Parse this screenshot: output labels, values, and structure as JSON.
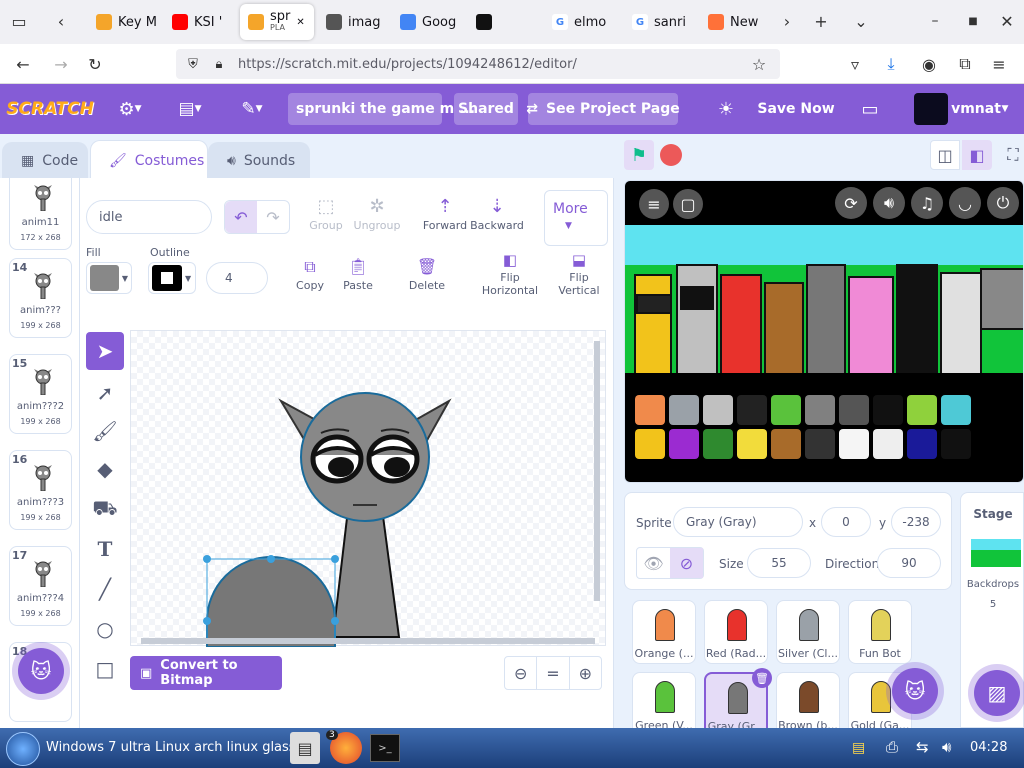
{
  "browser": {
    "tabs": [
      {
        "label": "Key M",
        "fav_color": "#f4a52a",
        "icon": "scratch-favicon"
      },
      {
        "label": "KSI '",
        "fav_color": "#ff0000",
        "icon": "youtube-favicon"
      },
      {
        "label": "spr",
        "sublabel": "PLA",
        "fav_color": "#f4a52a",
        "icon": "scratch-favicon",
        "active": true
      },
      {
        "label": "imag",
        "fav_color": "#555555",
        "icon": "image-favicon"
      },
      {
        "label": "Goog",
        "fav_color": "#4285f4",
        "icon": "docs-favicon"
      },
      {
        "label": "",
        "fav_color": "#111111",
        "icon": "qr-favicon"
      },
      {
        "label": "elmo",
        "fav_color": "#ffffff",
        "icon": "google-favicon"
      },
      {
        "label": "sanri",
        "fav_color": "#ffffff",
        "icon": "google-favicon"
      },
      {
        "label": "New",
        "fav_color": "#ff7139",
        "icon": "firefox-favicon"
      }
    ],
    "url": "https://scratch.mit.edu/projects/1094248612/editor/"
  },
  "menubar": {
    "logo": "SCRATCH",
    "project_title": "sprunki the game m ...",
    "shared_label": "Shared",
    "see_project_label": "See Project Page",
    "save_now_label": "Save Now",
    "username": "vmnat"
  },
  "editor_tabs": {
    "code": "Code",
    "costumes": "Costumes",
    "sounds": "Sounds"
  },
  "costumes": [
    {
      "num": "",
      "name": "anim11",
      "size": "172 x 268"
    },
    {
      "num": "14",
      "name": "anim???",
      "size": "199 x 268"
    },
    {
      "num": "15",
      "name": "anim???2",
      "size": "199 x 268"
    },
    {
      "num": "16",
      "name": "anim???3",
      "size": "199 x 268"
    },
    {
      "num": "17",
      "name": "anim???4",
      "size": "199 x 268"
    },
    {
      "num": "18",
      "name": "",
      "size": ""
    }
  ],
  "paint": {
    "costume_name": "idle",
    "group_label": "Group",
    "ungroup_label": "Ungroup",
    "forward_label": "Forward",
    "backward_label": "Backward",
    "more_label": "More",
    "fill_label": "Fill",
    "fill_color": "#888888",
    "outline_label": "Outline",
    "outline_width": "4",
    "copy_label": "Copy",
    "paste_label": "Paste",
    "delete_label": "Delete",
    "flip_h_label": "Flip\nHorizontal",
    "flip_v_label": "Flip\nVertical",
    "convert_label": "Convert to Bitmap",
    "zoom_reset": "="
  },
  "sprite_info": {
    "sprite_label": "Sprite",
    "sprite_name": "Gray (Gray)",
    "x_label": "x",
    "x": "0",
    "y_label": "y",
    "y": "-238",
    "size_label": "Size",
    "size": "55",
    "direction_label": "Direction",
    "direction": "90"
  },
  "sprites": [
    {
      "name": "Orange (...",
      "color": "#f08a4b"
    },
    {
      "name": "Red (Rad...",
      "color": "#e8322c"
    },
    {
      "name": "Silver (Cl...",
      "color": "#9aa1a8"
    },
    {
      "name": "Fun Bot",
      "color": "#e3d25a"
    },
    {
      "name": "Green (V...",
      "color": "#5ac23c"
    },
    {
      "name": "Gray (Gr...",
      "color": "#777777",
      "selected": true
    },
    {
      "name": "Brown (b...",
      "color": "#7b4a2a"
    },
    {
      "name": "Gold (Ga...",
      "color": "#e8c53b"
    }
  ],
  "stage_panel": {
    "label": "Stage",
    "backdrops_label": "Backdrops",
    "backdrops_count": "5"
  },
  "taskbar": {
    "start_text": "Windows 7 ultra Linux arch linux glass",
    "firefox_badge": "3",
    "clock": "04:28"
  },
  "palette_row1": [
    "#f08a4b",
    "#9aa1a8",
    "#c0c0c0",
    "#222222",
    "#5ac23c",
    "#808080",
    "#555555",
    "#111111",
    "#8fd13c",
    "#4ec9d6"
  ],
  "palette_row2": [
    "#f2c31b",
    "#9b2bd1",
    "#2f8a2f",
    "#f2dc3b",
    "#a86b2a",
    "#333333",
    "#f5f5f5",
    "#eeeeee",
    "#1a1a99",
    "#111111"
  ],
  "colors": {
    "accent": "#855cd6",
    "stage_green": "#11c43a",
    "stage_sky": "#5ee3f0"
  }
}
